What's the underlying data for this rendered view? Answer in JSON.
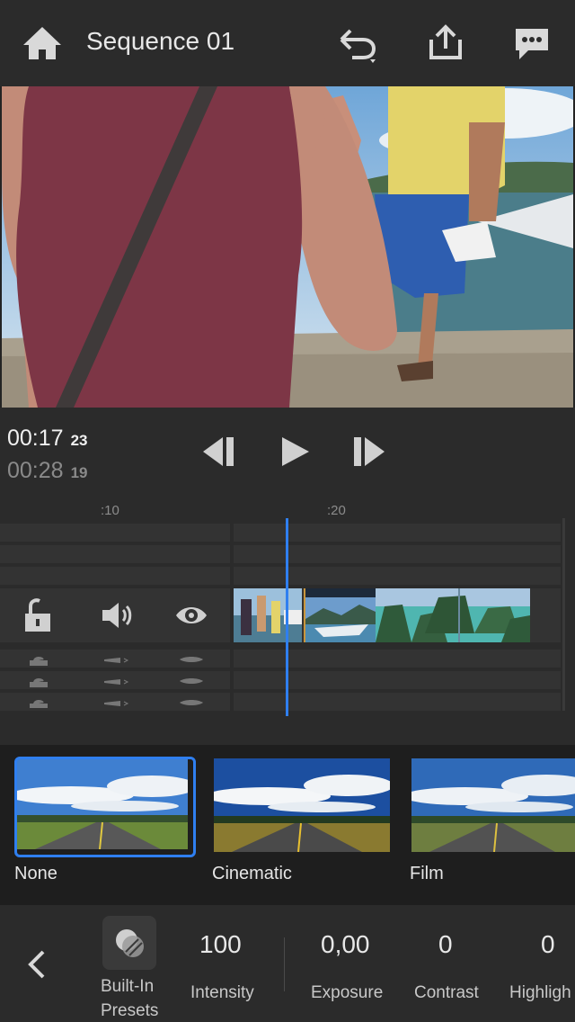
{
  "header": {
    "title": "Sequence 01"
  },
  "player": {
    "current_time": "00:17",
    "current_frames": "23",
    "total_time": "00:28",
    "total_frames": "19"
  },
  "timeline": {
    "ruler_labels": [
      ":10",
      ":20"
    ]
  },
  "presets": {
    "items": [
      {
        "label": "None",
        "selected": true
      },
      {
        "label": "Cinematic",
        "selected": false
      },
      {
        "label": "Film",
        "selected": false
      }
    ]
  },
  "toolbar": {
    "builtin_presets_label_line1": "Built-In",
    "builtin_presets_label_line2": "Presets",
    "params": [
      {
        "value": "100",
        "label": "Intensity"
      },
      {
        "value": "0,00",
        "label": "Exposure"
      },
      {
        "value": "0",
        "label": "Contrast"
      },
      {
        "value": "0",
        "label": "Highligh"
      }
    ]
  },
  "colors": {
    "accent": "#2f7ff0",
    "background": "#232323",
    "panel": "#2b2b2b"
  },
  "icons": [
    "home-icon",
    "undo-icon",
    "share-icon",
    "comment-icon",
    "step-back-icon",
    "play-icon",
    "step-forward-icon",
    "lock-icon",
    "audio-icon",
    "eye-icon",
    "chevron-left-icon",
    "presets-icon"
  ]
}
